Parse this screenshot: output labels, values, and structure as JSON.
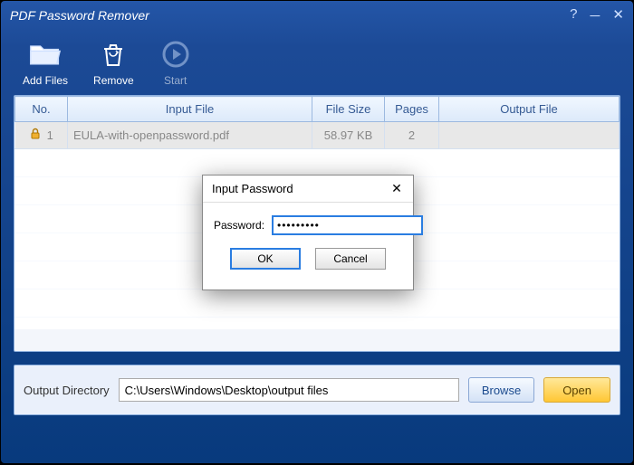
{
  "window": {
    "title": "PDF Password Remover"
  },
  "toolbar": {
    "add_files": "Add Files",
    "remove": "Remove",
    "start": "Start"
  },
  "table": {
    "headers": {
      "no": "No.",
      "input_file": "Input File",
      "file_size": "File Size",
      "pages": "Pages",
      "output_file": "Output File"
    },
    "rows": [
      {
        "no": "1",
        "input_file": "EULA-with-openpassword.pdf",
        "file_size": "58.97 KB",
        "pages": "2",
        "output_file": ""
      }
    ]
  },
  "footer": {
    "label": "Output Directory",
    "path": "C:\\Users\\Windows\\Desktop\\output files",
    "browse": "Browse",
    "open": "Open"
  },
  "modal": {
    "title": "Input Password",
    "password_label": "Password:",
    "password_value": "•••••••••",
    "ok": "OK",
    "cancel": "Cancel"
  }
}
